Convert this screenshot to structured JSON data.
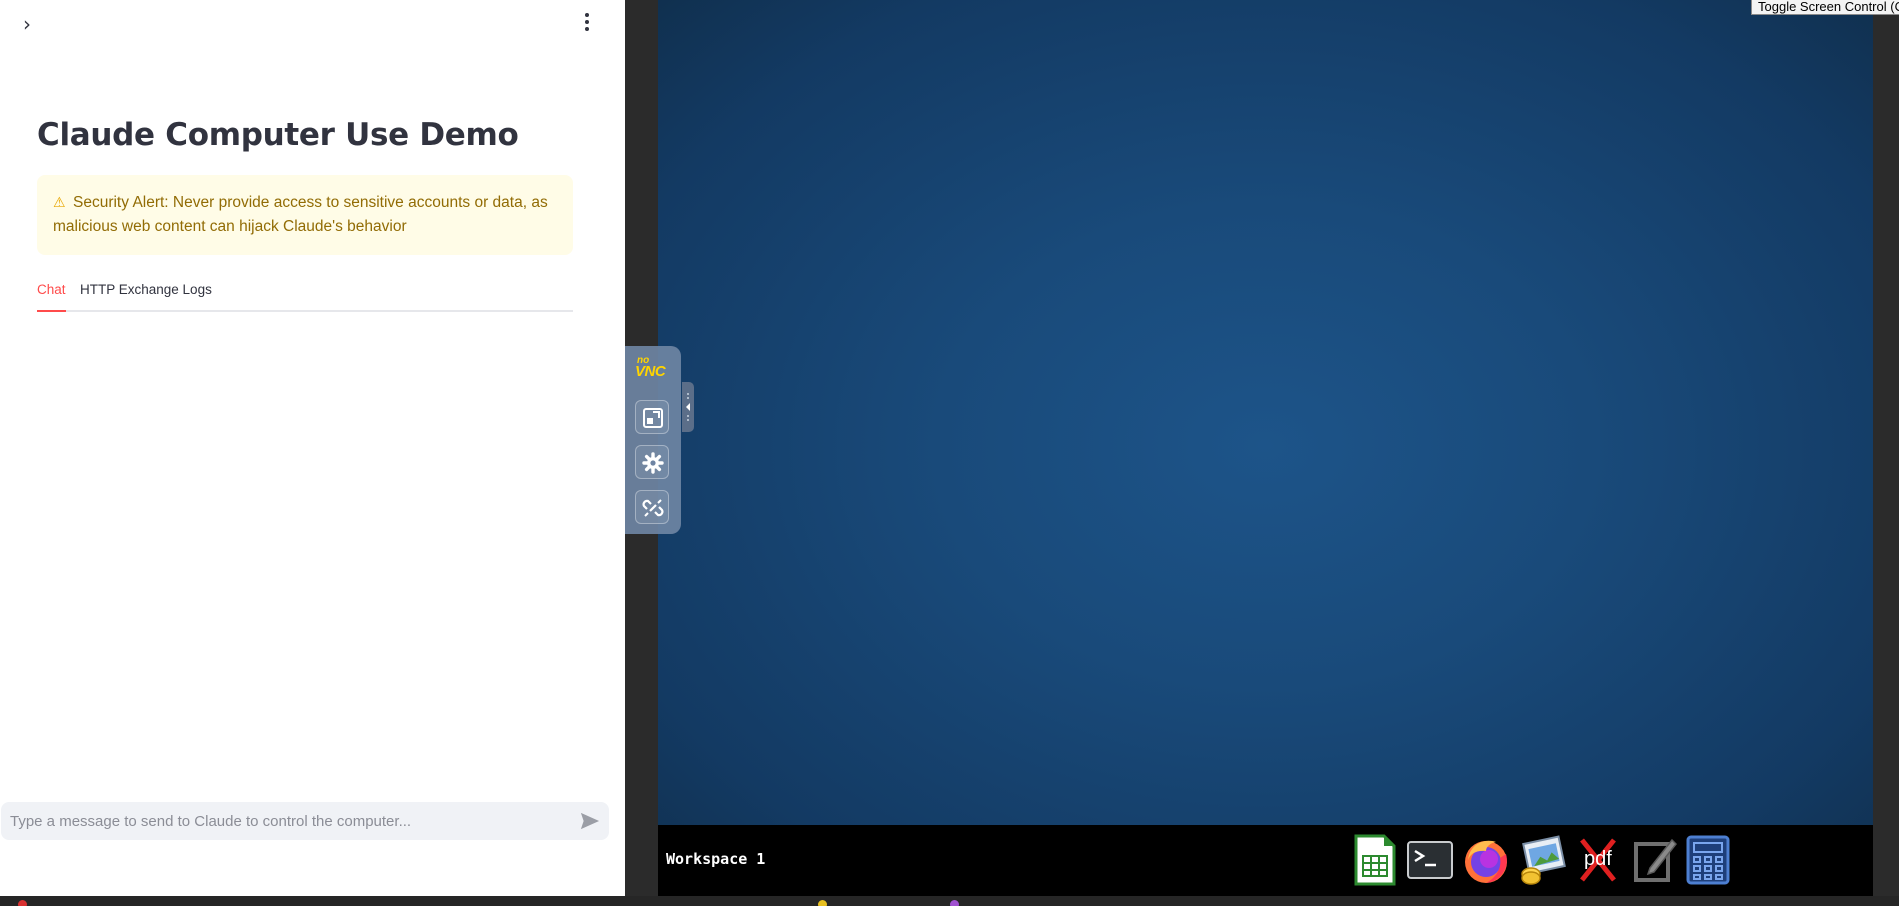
{
  "streamlit": {
    "title": "Claude Computer Use Demo",
    "alert": {
      "icon": "warning-icon",
      "text": "Security Alert: Never provide access to sensitive accounts or data, as malicious web content can hijack Claude's behavior"
    },
    "tabs": [
      {
        "label": "Chat",
        "active": true
      },
      {
        "label": "HTTP Exchange Logs",
        "active": false
      }
    ],
    "chat_input": {
      "placeholder": "Type a message to send to Claude to control the computer...",
      "value": ""
    }
  },
  "vnc": {
    "toggle_button": "Toggle Screen Control (Off)",
    "logo": {
      "top": "no",
      "bottom": "VNC"
    },
    "controls": [
      "fullscreen-icon",
      "settings-icon",
      "disconnect-icon"
    ],
    "taskbar": {
      "workspace": "Workspace 1",
      "apps": [
        "spreadsheet-icon",
        "terminal-icon",
        "firefox-icon",
        "image-viewer-icon",
        "pdf-icon",
        "text-editor-icon",
        "calculator-icon"
      ],
      "pdf_label": "pdf"
    }
  },
  "colors": {
    "accent": "#ff4b4b",
    "alert_bg": "#fffce7",
    "alert_text": "#926c05",
    "desktop": "#1b4f84",
    "novnc_logo": "#ffd400"
  }
}
